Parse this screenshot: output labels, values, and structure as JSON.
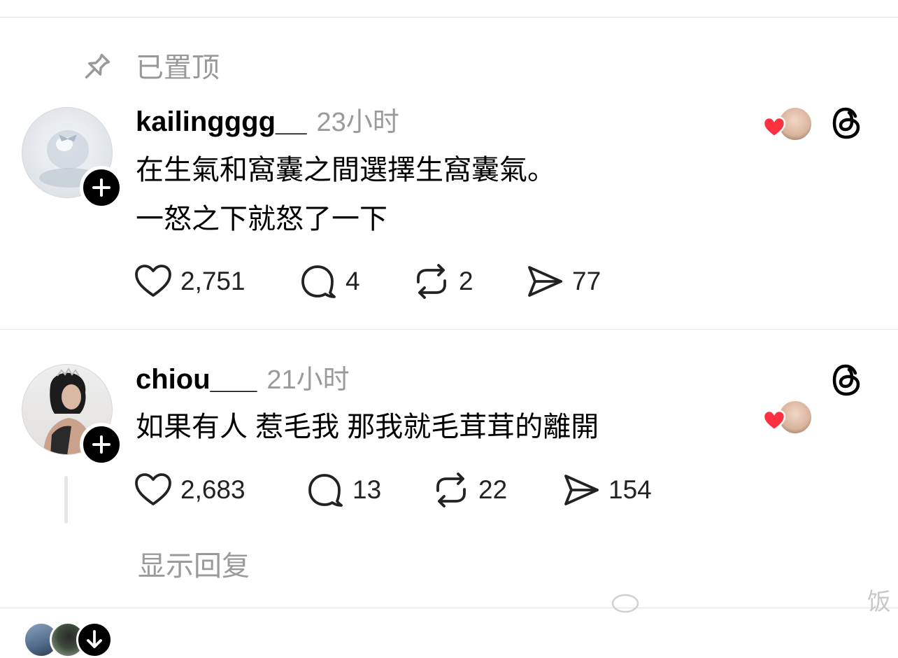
{
  "pinned": {
    "label": "已置顶",
    "icon": "pin-icon"
  },
  "posts": [
    {
      "username": "kailingggg__",
      "time": "23小时",
      "lines": [
        "在生氣和窩囊之間選擇生窩囊氣。",
        "一怒之下就怒了一下"
      ],
      "likes": "2,751",
      "comments": "4",
      "reposts": "2",
      "shares": "77"
    },
    {
      "username": "chiou___",
      "time": "21小时",
      "lines": [
        "如果有人 惹毛我 那我就毛茸茸的離開"
      ],
      "likes": "2,683",
      "comments": "13",
      "reposts": "22",
      "shares": "154"
    }
  ],
  "show_replies": "显示回复",
  "watermark": "饭",
  "colors": {
    "heart": "#ff3040",
    "muted": "#999999",
    "text": "#000000"
  }
}
